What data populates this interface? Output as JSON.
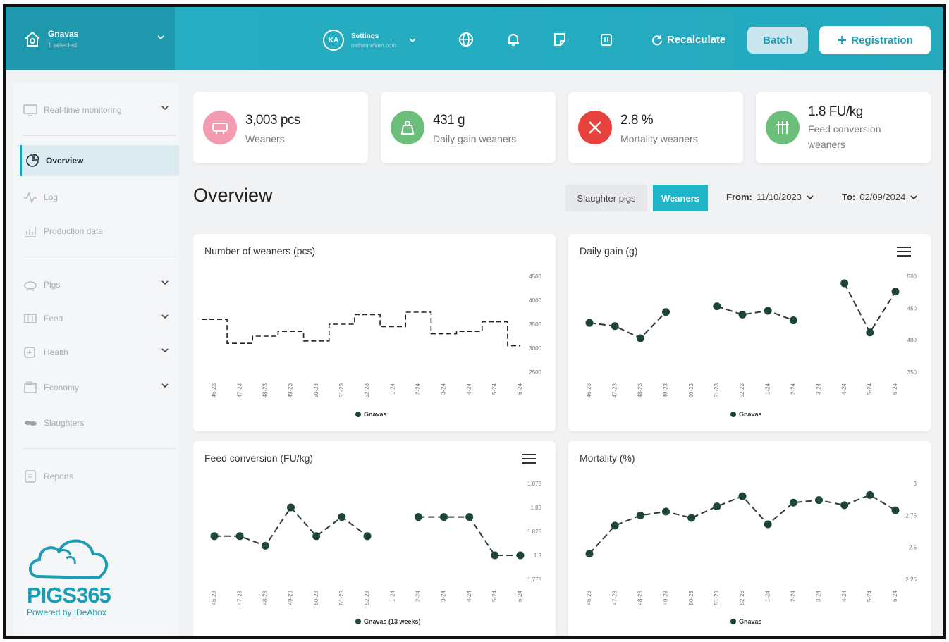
{
  "header": {
    "farm_name": "Gnavas",
    "farm_sub": "1 selected",
    "avatar_initials": "KA",
    "user_title": "Settings",
    "user_sub": "nathanrefsen.com",
    "recalculate_label": "Recalculate",
    "batch_label": "Batch",
    "registration_label": "Registration",
    "icons": [
      "globe-icon",
      "bell-icon",
      "note-icon",
      "trash-icon"
    ]
  },
  "sidebar": {
    "items": [
      {
        "label": "Real-time monitoring",
        "icon": "monitor-icon",
        "chevron": true
      },
      {
        "label": "Overview",
        "icon": "pie-icon",
        "active": true
      },
      {
        "label": "Log",
        "icon": "pulse-icon"
      },
      {
        "label": "Production data",
        "icon": "chart-icon"
      },
      {
        "label": "Pigs",
        "icon": "pig-icon",
        "chevron": true
      },
      {
        "label": "Feed",
        "icon": "feed-icon",
        "chevron": true
      },
      {
        "label": "Health",
        "icon": "health-icon",
        "chevron": true
      },
      {
        "label": "Economy",
        "icon": "economy-icon",
        "chevron": true
      },
      {
        "label": "Slaughters",
        "icon": "slaughter-icon"
      },
      {
        "label": "Reports",
        "icon": "report-icon"
      }
    ],
    "brand": "PIGS365",
    "powered": "Powered by IDeAbox"
  },
  "kpis": [
    {
      "value": "3,003 pcs",
      "label": "Weaners",
      "color": "#f29bb1",
      "icon": "pig-icon"
    },
    {
      "value": "431 g",
      "label": "Daily gain weaners",
      "color": "#6cbf7b",
      "icon": "weight-icon"
    },
    {
      "value": "2.8 %",
      "label": "Mortality weaners",
      "color": "#e9423c",
      "icon": "cross-icon"
    },
    {
      "value": "1.8 FU/kg",
      "label": "Feed conversion weaners",
      "color": "#6cbf7b",
      "icon": "feed-icon"
    }
  ],
  "page": {
    "title": "Overview",
    "toggle_off": "Slaughter pigs",
    "toggle_on": "Weaners",
    "from_label": "From:",
    "from_value": "11/10/2023",
    "to_label": "To:",
    "to_value": "02/09/2024"
  },
  "chart_data": [
    {
      "type": "line",
      "title": "Number of weaners (pcs)",
      "categories": [
        "46-23",
        "47-23",
        "48-23",
        "49-23",
        "50-23",
        "51-23",
        "52-23",
        "1-24",
        "2-24",
        "3-24",
        "4-24",
        "5-24",
        "6-24"
      ],
      "ylim": [
        2500,
        4500
      ],
      "yticks": [
        2500,
        3000,
        3500,
        4000,
        4500
      ],
      "series": [
        {
          "name": "Gnavas",
          "values": [
            3600,
            3100,
            3250,
            3350,
            3150,
            3500,
            3700,
            3450,
            3750,
            3300,
            3350,
            3550,
            3050
          ]
        }
      ],
      "style": "stepped-dashed"
    },
    {
      "type": "line",
      "title": "Daily gain (g)",
      "categories": [
        "46-23",
        "47-23",
        "48-23",
        "49-23",
        "50-23",
        "51-23",
        "52-23",
        "1-24",
        "2-24",
        "3-24",
        "4-24",
        "5-24",
        "6-24"
      ],
      "ylim": [
        350,
        500
      ],
      "yticks": [
        350,
        400,
        450,
        500
      ],
      "series": [
        {
          "name": "Gnavas",
          "values": [
            427,
            422,
            403,
            444,
            null,
            453,
            440,
            446,
            431,
            null,
            489,
            412,
            476
          ]
        }
      ]
    },
    {
      "type": "line",
      "title": "Feed conversion (FU/kg)",
      "categories": [
        "46-23",
        "47-23",
        "48-23",
        "49-23",
        "50-23",
        "51-23",
        "52-23",
        "1-24",
        "2-24",
        "3-24",
        "4-24",
        "5-24",
        "6-24"
      ],
      "ylim": [
        1.775,
        1.875
      ],
      "yticks": [
        1.775,
        1.8,
        1.825,
        1.85,
        1.875
      ],
      "series": [
        {
          "name": "Gnavas (13 weeks)",
          "values": [
            1.82,
            1.82,
            1.81,
            1.85,
            1.82,
            1.84,
            1.82,
            null,
            1.84,
            1.84,
            1.84,
            1.8,
            1.8
          ]
        }
      ]
    },
    {
      "type": "line",
      "title": "Mortality (%)",
      "categories": [
        "46-23",
        "47-23",
        "48-23",
        "49-23",
        "50-23",
        "51-23",
        "52-23",
        "1-24",
        "2-24",
        "3-24",
        "4-24",
        "5-24",
        "6-24"
      ],
      "ylim": [
        2.25,
        3
      ],
      "yticks": [
        2.25,
        2.5,
        2.75,
        3
      ],
      "series": [
        {
          "name": "Gnavas",
          "values": [
            2.45,
            2.67,
            2.75,
            2.78,
            2.73,
            2.82,
            2.9,
            2.68,
            2.85,
            2.87,
            2.83,
            2.91,
            2.79
          ]
        }
      ]
    }
  ]
}
